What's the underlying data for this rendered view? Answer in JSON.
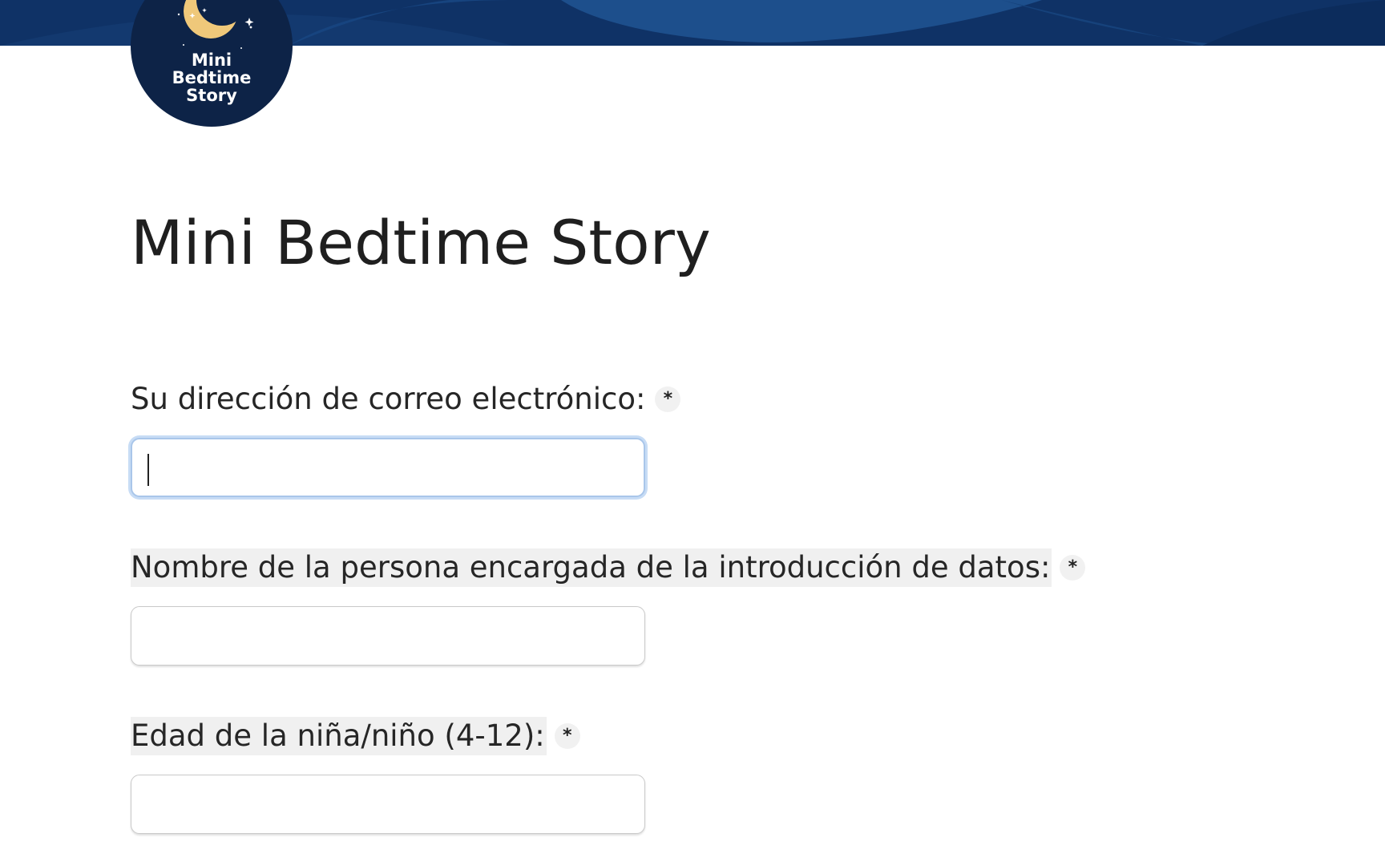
{
  "brand": {
    "logo_lines": [
      "Mini",
      "Bedtime",
      "Story"
    ],
    "banner_color": "#0f3266",
    "logo_bg": "#0d2347",
    "moon_color": "#efc87a"
  },
  "page": {
    "title": "Mini Bedtime Story"
  },
  "form": {
    "fields": [
      {
        "label": "Su dirección de correo electrónico:",
        "required_mark": "*",
        "value": "",
        "focused": true
      },
      {
        "label": "Nombre de la persona encargada de la introducción de datos:",
        "required_mark": "*",
        "value": "",
        "focused": false
      },
      {
        "label": "Edad de la niña/niño (4-12):",
        "required_mark": "*",
        "value": "",
        "focused": false
      }
    ]
  }
}
